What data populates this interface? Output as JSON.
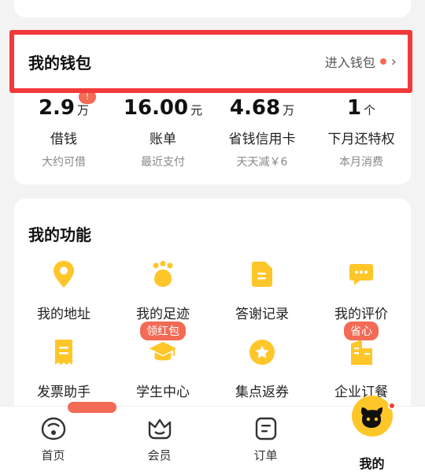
{
  "wallet": {
    "title": "我的钱包",
    "link": "进入钱包",
    "stats": [
      {
        "value": "2.9",
        "unit": "万",
        "name": "借钱",
        "sub": "大约可借",
        "badge": "!"
      },
      {
        "value": "16.00",
        "unit": "元",
        "name": "账单",
        "sub": "最近支付"
      },
      {
        "value": "4.68",
        "unit": "万",
        "name": "省钱信用卡",
        "sub": "天天减￥6"
      },
      {
        "value": "1",
        "unit": "个",
        "name": "下月还特权",
        "sub": "本月消费"
      }
    ]
  },
  "functions": {
    "title": "我的功能",
    "items": [
      {
        "label": "我的地址",
        "icon": "location-pin-icon"
      },
      {
        "label": "我的足迹",
        "icon": "paw-print-icon",
        "tag": "领红包"
      },
      {
        "label": "答谢记录",
        "icon": "document-icon"
      },
      {
        "label": "我的评价",
        "icon": "comment-icon",
        "tag": "省心"
      },
      {
        "label": "发票助手",
        "icon": "receipt-icon"
      },
      {
        "label": "学生中心",
        "icon": "graduation-cap-icon"
      },
      {
        "label": "集点返券",
        "icon": "star-coin-icon"
      },
      {
        "label": "企业订餐",
        "icon": "building-icon"
      }
    ]
  },
  "tabbar": [
    {
      "label": "首页",
      "icon": "home-face-icon"
    },
    {
      "label": "会员",
      "icon": "member-crown-icon"
    },
    {
      "label": "订单",
      "icon": "order-list-icon"
    },
    {
      "label": "我的",
      "icon": "profile-avatar-icon",
      "active": true
    }
  ],
  "colors": {
    "accent": "#ffc629",
    "badge": "#f36a55",
    "highlight": "#f23a3a",
    "background": "#f3f3f3"
  }
}
